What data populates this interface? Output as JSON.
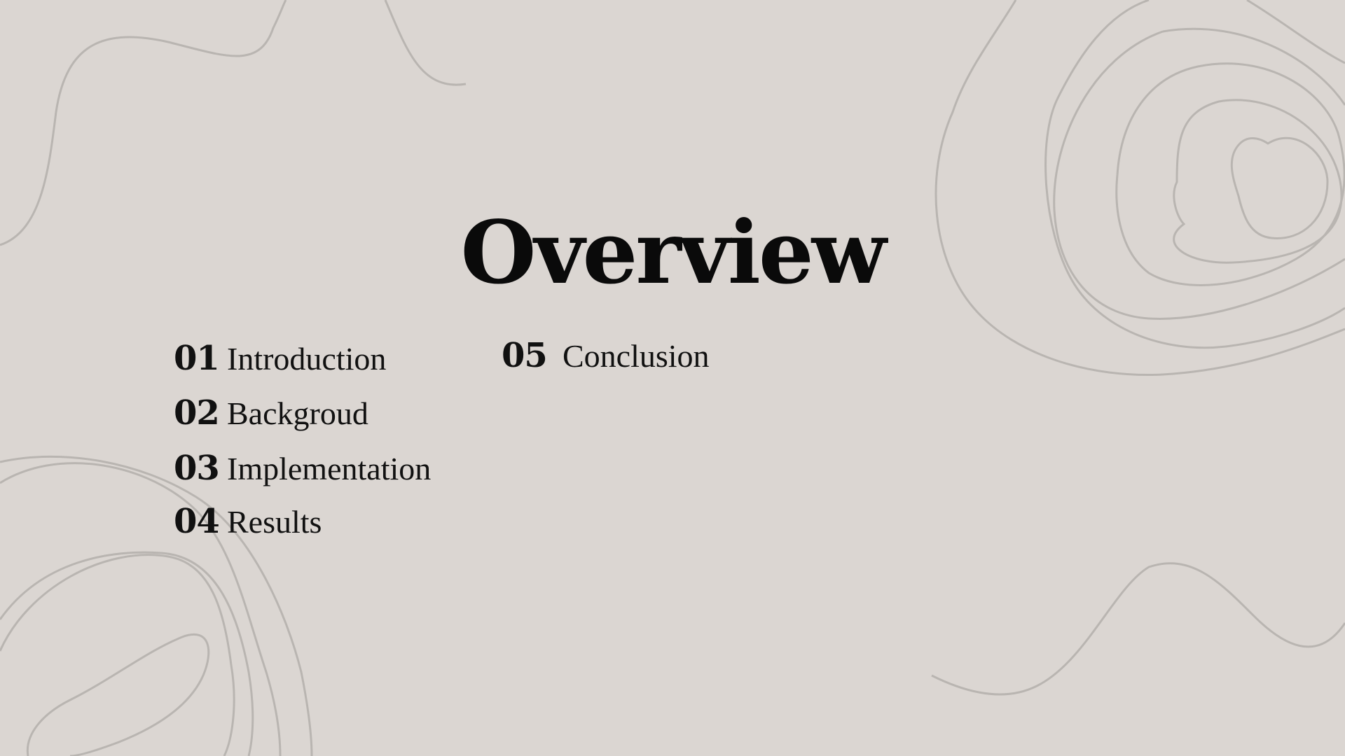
{
  "slide": {
    "title": "Overview",
    "items": [
      {
        "number": "01",
        "label": "Introduction"
      },
      {
        "number": "02",
        "label": "Backgroud"
      },
      {
        "number": "03",
        "label": "Implementation"
      },
      {
        "number": "04",
        "label": "Results"
      },
      {
        "number": "05",
        "label": "Conclusion"
      }
    ]
  },
  "colors": {
    "background": "#dbd6d2",
    "line": "#b9b5b1",
    "text": "#0a0a0a"
  }
}
